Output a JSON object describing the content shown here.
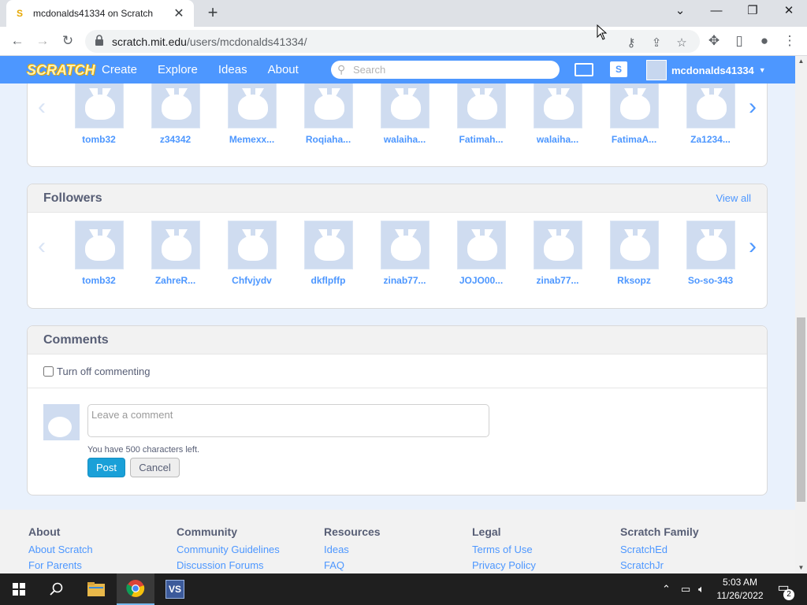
{
  "browser": {
    "tab_title": "mcdonalds41334 on Scratch",
    "tab_favicon": "scratch-favicon",
    "url_host": "scratch.mit.edu",
    "url_path": "/users/mcdonalds41334/"
  },
  "nav": {
    "logo": "SCRATCH",
    "links": [
      "Create",
      "Explore",
      "Ideas",
      "About"
    ],
    "search_placeholder": "Search",
    "username": "mcdonalds41334"
  },
  "following": {
    "names": [
      "tomb32",
      "z34342",
      "Memexx...",
      "Roqiaha...",
      "walaiha...",
      "Fatimah...",
      "walaiha...",
      "FatimaA...",
      "Za1234..."
    ]
  },
  "followers": {
    "title": "Followers",
    "view_all": "View all",
    "names": [
      "tomb32",
      "ZahreR...",
      "Chfvjydv",
      "dkflpffp",
      "zinab77...",
      "JOJO00...",
      "zinab77...",
      "Rksopz",
      "So-so-343"
    ]
  },
  "comments": {
    "title": "Comments",
    "toggle_label": "Turn off commenting",
    "placeholder": "Leave a comment",
    "chars_left": "You have 500 characters left.",
    "post_label": "Post",
    "cancel_label": "Cancel"
  },
  "footer": {
    "columns": [
      {
        "title": "About",
        "links": [
          "About Scratch",
          "For Parents"
        ]
      },
      {
        "title": "Community",
        "links": [
          "Community Guidelines",
          "Discussion Forums"
        ]
      },
      {
        "title": "Resources",
        "links": [
          "Ideas",
          "FAQ"
        ]
      },
      {
        "title": "Legal",
        "links": [
          "Terms of Use",
          "Privacy Policy"
        ]
      },
      {
        "title": "Scratch Family",
        "links": [
          "ScratchEd",
          "ScratchJr"
        ]
      }
    ]
  },
  "taskbar": {
    "time": "5:03 AM",
    "date": "11/26/2022",
    "notification_count": "2"
  },
  "colors": {
    "scratch_blue": "#4d97ff",
    "post_button": "#1aa0d8"
  }
}
